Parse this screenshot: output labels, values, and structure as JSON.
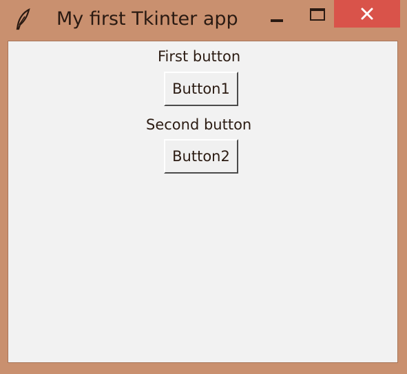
{
  "window": {
    "title": "My first Tkinter app",
    "app_icon": "feather-icon",
    "controls": {
      "minimize_icon": "minimize-icon",
      "maximize_icon": "maximize-icon",
      "close_icon": "close-icon",
      "close_color": "#d9534a"
    }
  },
  "content": {
    "items": [
      {
        "label": "First button",
        "button": "Button1"
      },
      {
        "label": "Second button",
        "button": "Button2"
      }
    ]
  },
  "colors": {
    "frame": "#c9906f",
    "client_bg": "#f2f2f2"
  }
}
